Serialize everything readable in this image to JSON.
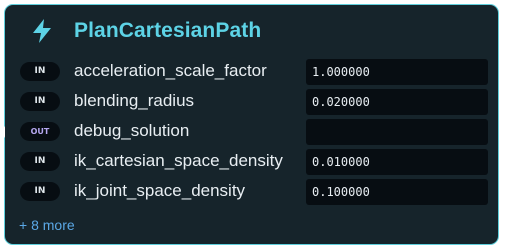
{
  "node": {
    "title": "PlanCartesianPath",
    "icon": "lightning-bolt-icon",
    "accent_color": "#5dd3e6",
    "border_color": "#5fcfdc",
    "background_color": "#16242b"
  },
  "ports": [
    {
      "direction": "IN",
      "label": "acceleration_scale_factor",
      "value": "1.000000"
    },
    {
      "direction": "IN",
      "label": "blending_radius",
      "value": "0.020000"
    },
    {
      "direction": "OUT",
      "label": "debug_solution",
      "value": ""
    },
    {
      "direction": "IN",
      "label": "ik_cartesian_space_density",
      "value": "0.010000"
    },
    {
      "direction": "IN",
      "label": "ik_joint_space_density",
      "value": "0.100000"
    }
  ],
  "more_link": "+ 8 more"
}
